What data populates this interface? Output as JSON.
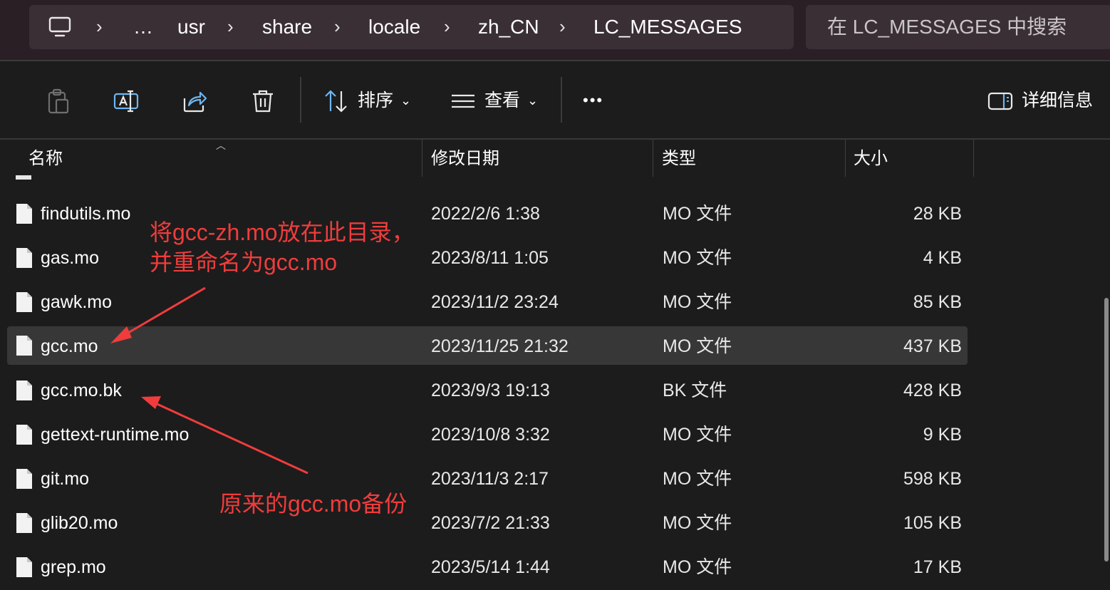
{
  "address_bar": {
    "breadcrumbs": [
      "…",
      "usr",
      "share",
      "locale",
      "zh_CN",
      "LC_MESSAGES"
    ],
    "search_placeholder": "在 LC_MESSAGES 中搜索"
  },
  "toolbar": {
    "sort_label": "排序",
    "view_label": "查看",
    "more_label": "•••",
    "details_label": "详细信息"
  },
  "columns": {
    "name": "名称",
    "date": "修改日期",
    "type": "类型",
    "size": "大小"
  },
  "files": [
    {
      "name": "findutils.mo",
      "date": "2022/2/6 1:38",
      "type": "MO 文件",
      "size": "28 KB",
      "selected": false
    },
    {
      "name": "gas.mo",
      "date": "2023/8/11 1:05",
      "type": "MO 文件",
      "size": "4 KB",
      "selected": false
    },
    {
      "name": "gawk.mo",
      "date": "2023/11/2 23:24",
      "type": "MO 文件",
      "size": "85 KB",
      "selected": false
    },
    {
      "name": "gcc.mo",
      "date": "2023/11/25 21:32",
      "type": "MO 文件",
      "size": "437 KB",
      "selected": true
    },
    {
      "name": "gcc.mo.bk",
      "date": "2023/9/3 19:13",
      "type": "BK 文件",
      "size": "428 KB",
      "selected": false
    },
    {
      "name": "gettext-runtime.mo",
      "date": "2023/10/8 3:32",
      "type": "MO 文件",
      "size": "9 KB",
      "selected": false
    },
    {
      "name": "git.mo",
      "date": "2023/11/3 2:17",
      "type": "MO 文件",
      "size": "598 KB",
      "selected": false
    },
    {
      "name": "glib20.mo",
      "date": "2023/7/2 21:33",
      "type": "MO 文件",
      "size": "105 KB",
      "selected": false
    },
    {
      "name": "grep.mo",
      "date": "2023/5/14 1:44",
      "type": "MO 文件",
      "size": "17 KB",
      "selected": false
    }
  ],
  "annotations": {
    "top_line1": "将gcc-zh.mo放在此目录，",
    "top_line2": "并重命名为gcc.mo",
    "bottom": "原来的gcc.mo备份",
    "color": "#f03c3c"
  },
  "colors": {
    "background": "#1c1c1c",
    "topbar": "#2a1f25",
    "address_field": "#3a2f35",
    "selected_row": "#373737"
  }
}
